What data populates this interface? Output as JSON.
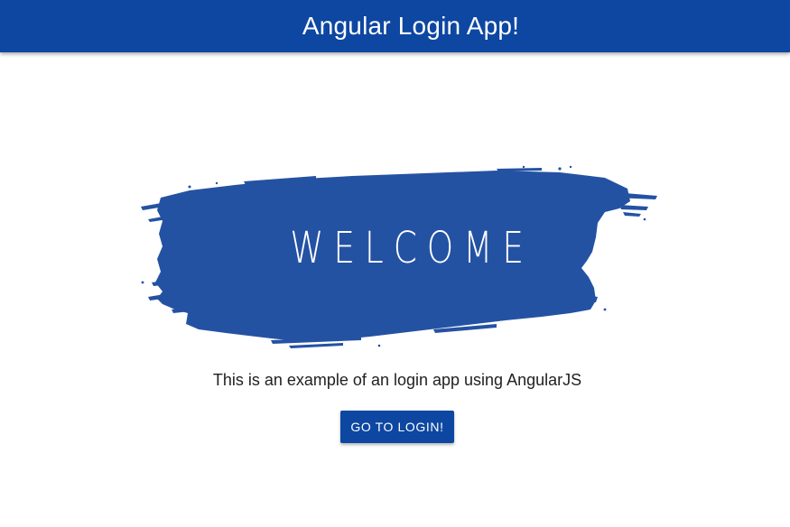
{
  "header": {
    "title": "Angular Login App!"
  },
  "hero": {
    "banner_text": "WELCOME",
    "brush_color": "#2452a3"
  },
  "main": {
    "description": "This is an example of an login app using AngularJS",
    "login_button_label": "GO TO LOGIN!"
  },
  "colors": {
    "primary": "#0d47a1",
    "text": "#212121",
    "background": "#ffffff"
  }
}
